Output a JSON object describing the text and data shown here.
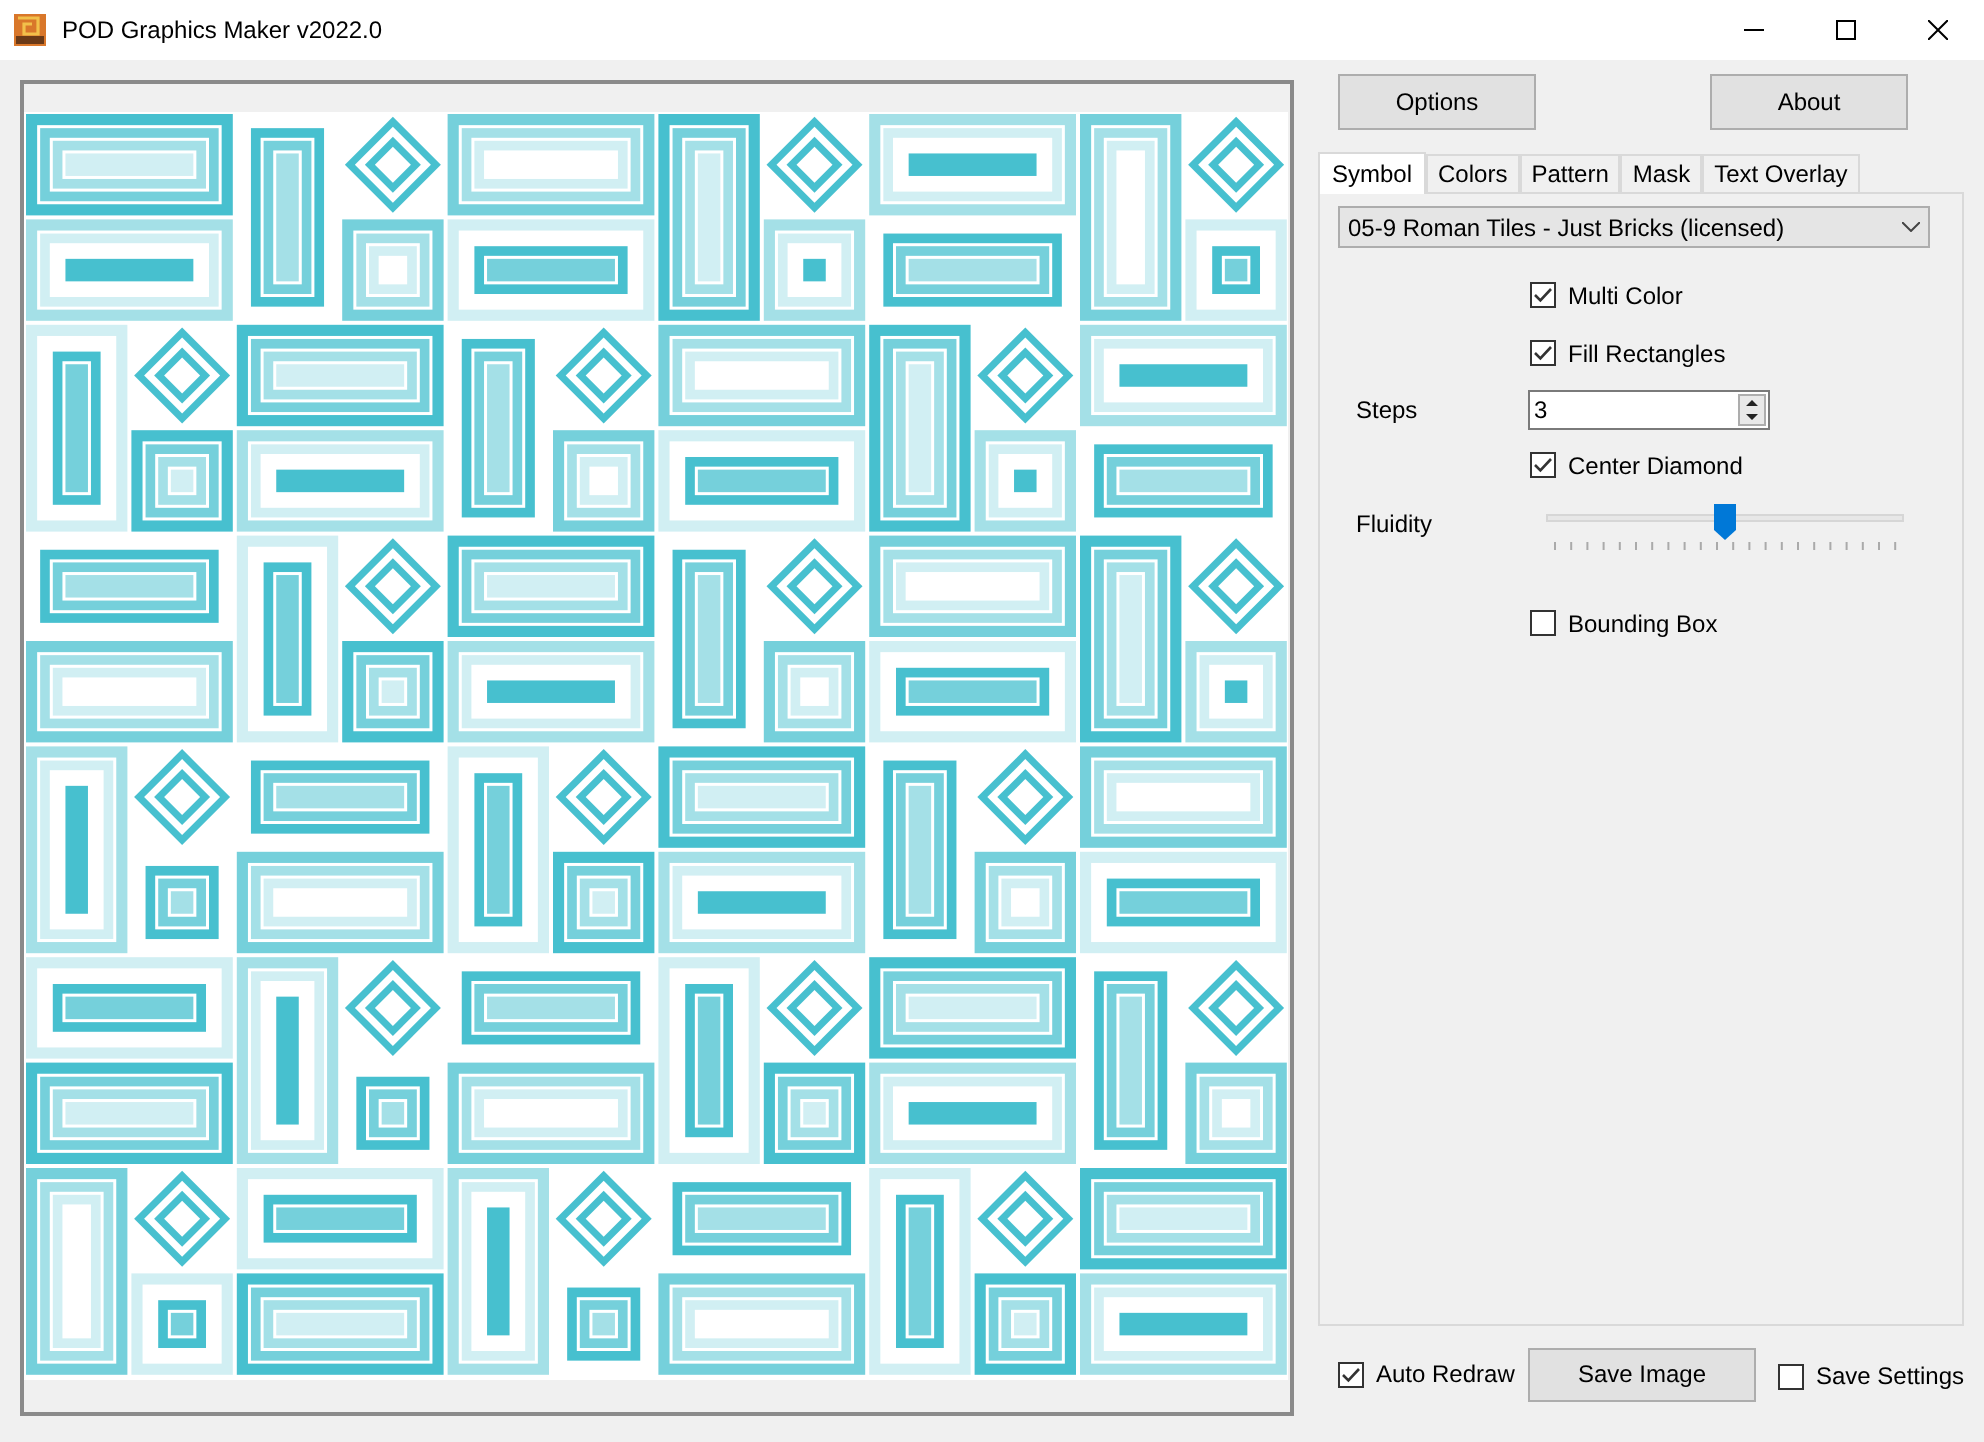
{
  "window": {
    "title": "POD Graphics Maker v2022.0"
  },
  "top_buttons": [
    "Options",
    "About"
  ],
  "tabs": [
    {
      "label": "Symbol",
      "selected": true
    },
    {
      "label": "Colors",
      "selected": false
    },
    {
      "label": "Pattern",
      "selected": false
    },
    {
      "label": "Mask",
      "selected": false
    },
    {
      "label": "Text Overlay",
      "selected": false
    }
  ],
  "symbol_dropdown": {
    "value": "05-9 Roman Tiles - Just Bricks (licensed)"
  },
  "controls": [
    {
      "kind": "checkbox",
      "label": "Multi Color",
      "checked": true
    },
    {
      "kind": "checkbox",
      "label": "Fill Rectangles",
      "checked": true
    },
    {
      "kind": "spinner",
      "label": "Steps",
      "value": "3"
    },
    {
      "kind": "checkbox",
      "label": "Center Diamond",
      "checked": true
    },
    {
      "kind": "slider",
      "label": "Fluidity",
      "level": 0.5
    },
    {
      "kind": "checkbox",
      "label": "Bounding Box",
      "checked": false
    }
  ],
  "footer": {
    "auto_redraw": {
      "label": "Auto Redraw",
      "checked": true
    },
    "save_button": "Save Image",
    "save_settings": {
      "label": "Save Settings",
      "checked": false
    }
  }
}
